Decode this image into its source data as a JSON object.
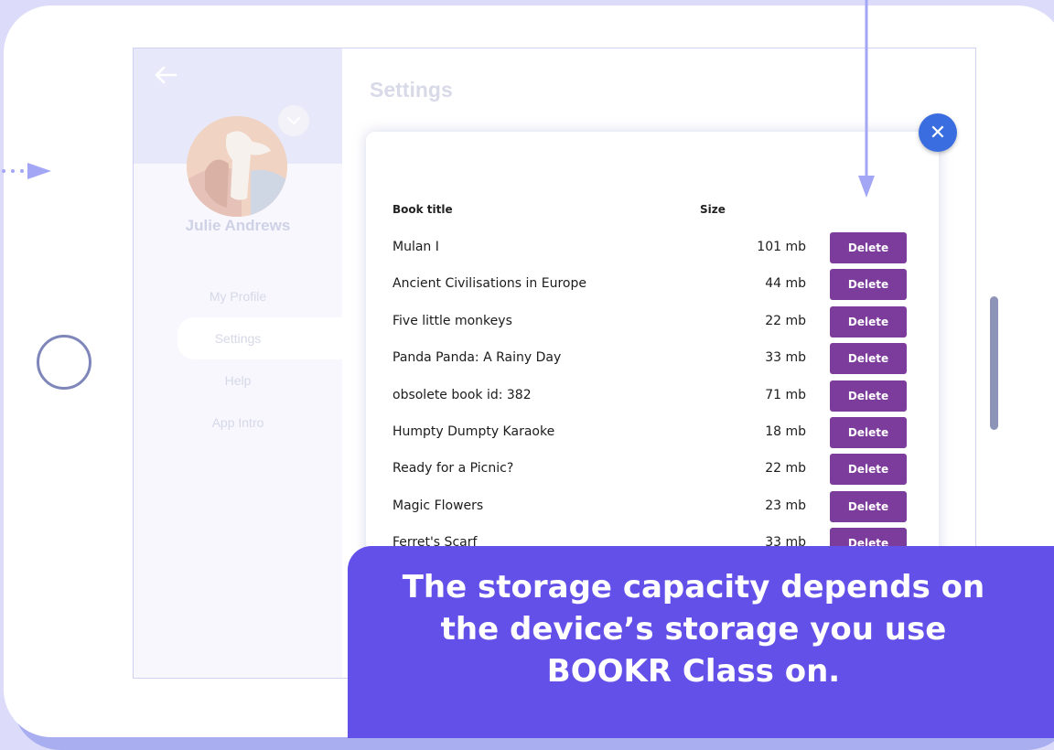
{
  "sidebar": {
    "user_name": "Julie Andrews",
    "menu": [
      "My Profile",
      "Settings",
      "Help",
      "App Intro"
    ],
    "active_item": "Settings"
  },
  "main": {
    "title": "Settings"
  },
  "modal": {
    "col_title": "Book title",
    "col_size": "Size",
    "delete_label": "Delete",
    "books": [
      {
        "title": "Mulan I",
        "size": "101 mb"
      },
      {
        "title": "Ancient Civilisations in Europe",
        "size": "44 mb"
      },
      {
        "title": "Five little monkeys",
        "size": "22 mb"
      },
      {
        "title": "Panda Panda: A Rainy Day",
        "size": "33 mb"
      },
      {
        "title": "obsolete book id: 382",
        "size": "71 mb"
      },
      {
        "title": "Humpty Dumpty Karaoke",
        "size": "18 mb"
      },
      {
        "title": "Ready for a Picnic?",
        "size": "22 mb"
      },
      {
        "title": "Magic Flowers",
        "size": "23 mb"
      },
      {
        "title": "Ferret's Scarf",
        "size": "33 mb"
      }
    ]
  },
  "callout": {
    "line1": "The storage capacity depends on",
    "line2": "the device’s storage you use",
    "line3": "BOOKR Class on."
  },
  "icons": {
    "close": "close-icon",
    "back": "back-arrow-icon",
    "dropdown": "chevron-down-icon"
  },
  "colors": {
    "delete_button": "#7c3c9b",
    "close_button": "#3a6ee0",
    "callout": "#6350e8",
    "annotation_arrow": "#a3a6f5"
  }
}
